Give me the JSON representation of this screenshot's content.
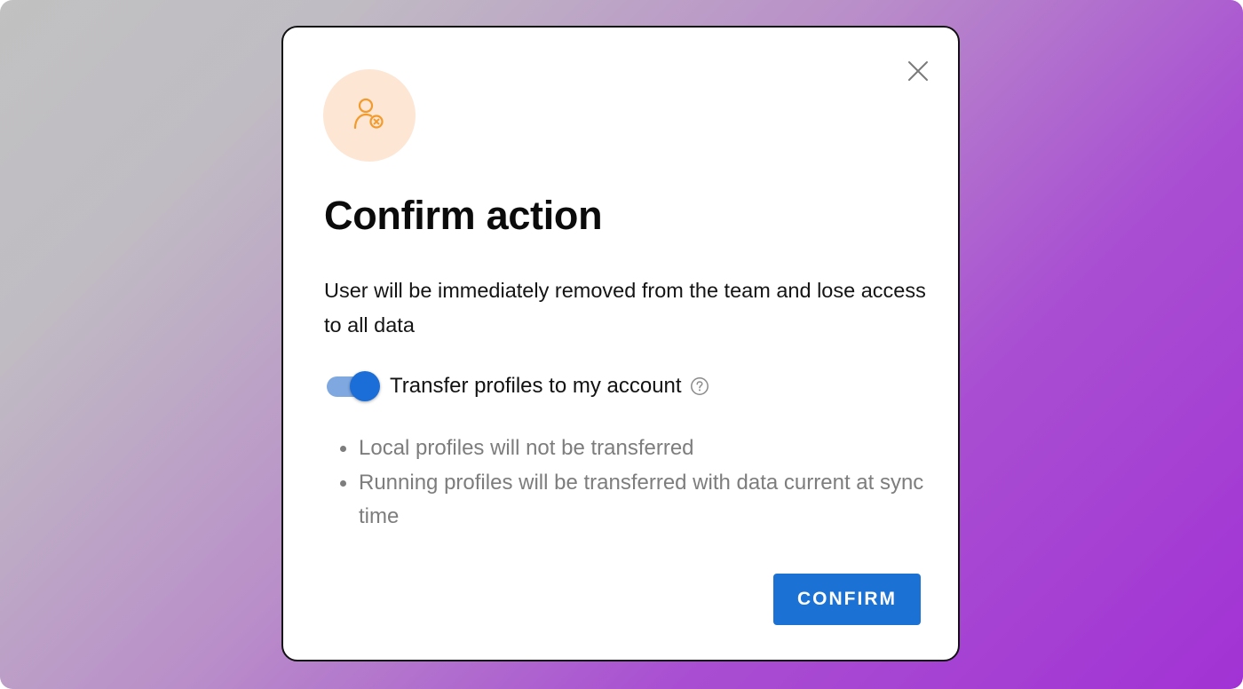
{
  "dialog": {
    "title": "Confirm action",
    "description": "User will be immediately removed from the team and lose access to all data",
    "toggle": {
      "label": "Transfer profiles to my account",
      "checked": true
    },
    "notes": [
      "Local profiles will not be transferred",
      "Running profiles will be transferred with data current at sync time"
    ],
    "confirm_label": "CONFIRM"
  },
  "icons": {
    "header": "user-remove-icon",
    "close": "close-icon",
    "help": "help-circle-icon"
  },
  "colors": {
    "accent": "#1b71d4",
    "toggle_track": "#7fa8e1",
    "icon_bg": "#fde6d4",
    "icon_stroke": "#f39a2a",
    "muted_text": "#7d7d7d",
    "backdrop_start": "#c1c1c1",
    "backdrop_end": "#a232d4"
  }
}
